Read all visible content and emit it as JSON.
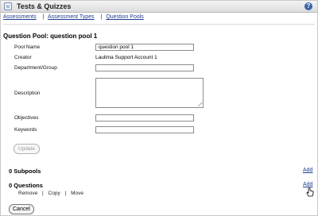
{
  "app": {
    "title": "Tests & Quizzes",
    "icon": "tool-icon",
    "help_icon": "help-icon"
  },
  "nav": {
    "items": [
      "Assessments",
      "Assessment Types",
      "Question Pools"
    ],
    "separator": "|"
  },
  "pool": {
    "heading": "Question Pool: question pool 1",
    "fields": {
      "pool_name_label": "Pool Name",
      "pool_name_value": "question pool 1",
      "creator_label": "Creator",
      "creator_value": "Laulima Support Account 1",
      "department_label": "Department/Group",
      "department_value": "",
      "description_label": "Description",
      "objectives_label": "Objectives",
      "objectives_value": "",
      "keywords_label": "Keywords",
      "keywords_value": ""
    },
    "update_label": "Update"
  },
  "subpools": {
    "title": "0 Subpools",
    "add_label": "Add"
  },
  "questions": {
    "title": "0 Questions",
    "add_label": "Add",
    "actions": [
      "Remove",
      "Copy",
      "Move"
    ],
    "separator": "|"
  },
  "cancel_label": "Cancel",
  "colors": {
    "link": "#1d3d8f",
    "border": "#c9c9c9"
  }
}
